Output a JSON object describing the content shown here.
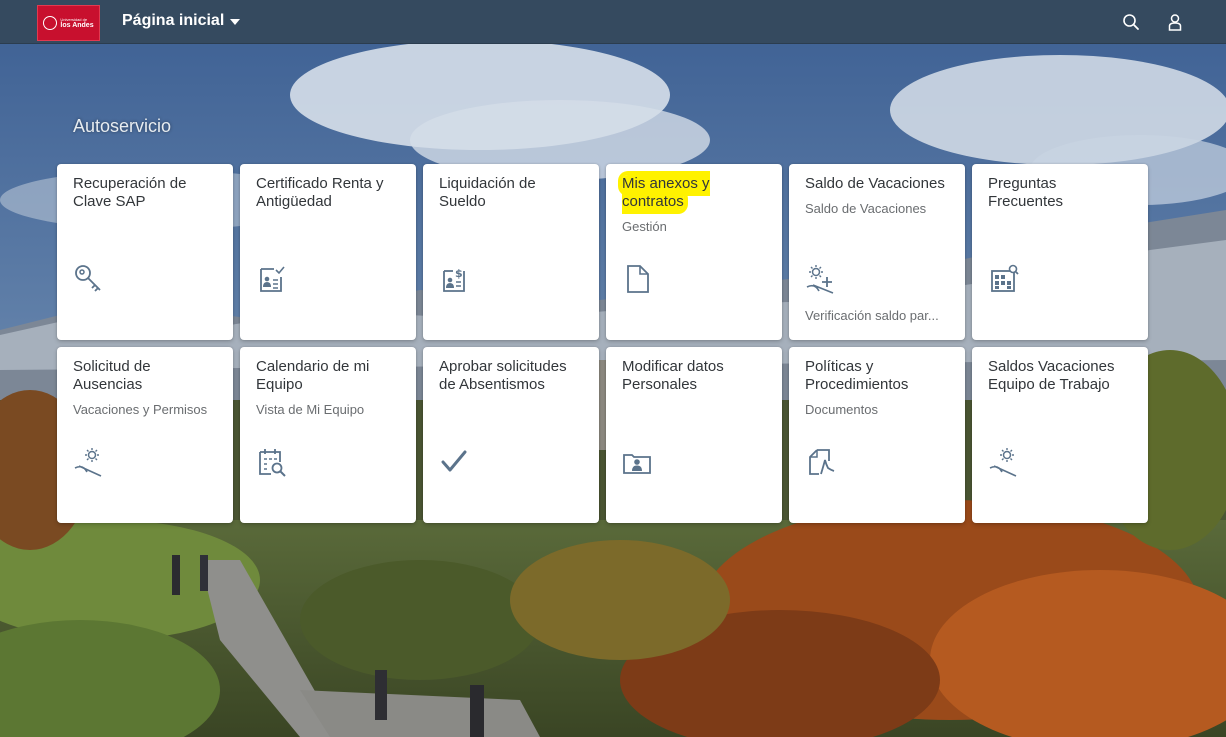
{
  "shell": {
    "logo_small": "Universidad de",
    "logo_big": "los Andes",
    "title": "Página inicial",
    "search_icon": "search-icon",
    "user_icon": "user-icon"
  },
  "group": {
    "title": "Autoservicio"
  },
  "tiles": [
    {
      "title": "Recuperación de Clave SAP",
      "subtitle": "",
      "footer": "",
      "icon": "key-icon"
    },
    {
      "title": "Certificado Renta y Antigüedad",
      "subtitle": "",
      "footer": "",
      "icon": "certificate-icon"
    },
    {
      "title": "Liquidación de Sueldo",
      "subtitle": "",
      "footer": "",
      "icon": "payslip-icon"
    },
    {
      "title": "Mis anexos y contratos",
      "subtitle": "Gestión",
      "footer": "",
      "icon": "document-icon",
      "highlight": "#fff200"
    },
    {
      "title": "Saldo de Vacaciones",
      "subtitle": "Saldo de Vacaciones",
      "footer": "Verificación saldo par...",
      "icon": "vacation-add-icon"
    },
    {
      "title": "Preguntas Frecuentes",
      "subtitle": "",
      "footer": "",
      "icon": "faq-icon"
    },
    {
      "title": "Solicitud de Ausencias",
      "subtitle": "Vacaciones y Permisos",
      "footer": "",
      "icon": "vacation-icon"
    },
    {
      "title": "Calendario de mi Equipo",
      "subtitle": "Vista de Mi Equipo",
      "footer": "",
      "icon": "calendar-search-icon"
    },
    {
      "title": "Aprobar solicitudes de Absentismos",
      "subtitle": "",
      "footer": "",
      "icon": "checkmark-icon"
    },
    {
      "title": "Modificar datos Personales",
      "subtitle": "",
      "footer": "",
      "icon": "personal-folder-icon"
    },
    {
      "title": "Políticas y Procedimientos",
      "subtitle": "Documentos",
      "footer": "",
      "icon": "pdf-document-icon"
    },
    {
      "title": "Saldos Vacaciones Equipo de Trabajo",
      "subtitle": "",
      "footer": "",
      "icon": "vacation-icon"
    }
  ],
  "colors": {
    "shell": "#354a5f",
    "tile_icon": "#5b738b",
    "logo": "#c8102e",
    "highlight": "#fff200"
  }
}
